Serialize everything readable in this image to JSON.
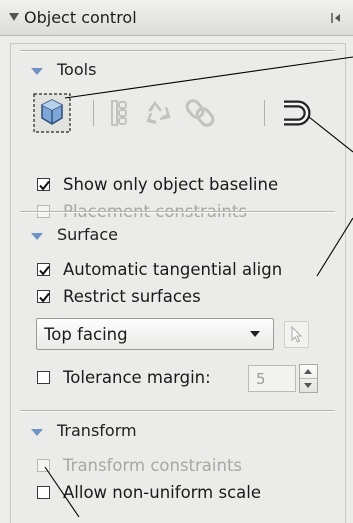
{
  "header": {
    "title": "Object control",
    "collapse_icon": "triangle-down-icon",
    "dock_icon": "panel-dock-icon"
  },
  "tools": {
    "title": "Tools",
    "buttons": [
      {
        "name": "select-object-tool",
        "icon": "cube-select-icon",
        "active": true,
        "enabled": true
      },
      {
        "name": "align-tool",
        "icon": "align-stack-icon",
        "enabled": false
      },
      {
        "name": "distribute-tool",
        "icon": "recycle-arrows-icon",
        "enabled": false
      },
      {
        "name": "link-tool",
        "icon": "chain-link-icon",
        "enabled": false
      },
      {
        "name": "attach-tool",
        "icon": "magnet-icon",
        "enabled": true
      }
    ],
    "show_baseline": {
      "label": "Show only object baseline",
      "checked": true,
      "enabled": true
    },
    "placement": {
      "label": "Placement constraints",
      "checked": false,
      "enabled": false
    }
  },
  "surface": {
    "title": "Surface",
    "auto_align": {
      "label": "Automatic tangential align",
      "checked": true,
      "enabled": true
    },
    "restrict": {
      "label": "Restrict surfaces",
      "checked": true,
      "enabled": true
    },
    "facing": {
      "value": "Top facing",
      "icon": "pointer-arrow-icon"
    },
    "tolerance": {
      "label": "Tolerance margin:",
      "checked": false,
      "enabled": true,
      "value": "5"
    }
  },
  "transform": {
    "title": "Transform",
    "constraints": {
      "label": "Transform constraints",
      "checked": false,
      "enabled": false
    },
    "non_uniform": {
      "label": "Allow non-uniform scale",
      "checked": false,
      "enabled": true
    }
  },
  "colors": {
    "accent": "#6f93c4",
    "disabled_text": "#a7a7a3",
    "panel_bg": "#ebebe9"
  }
}
